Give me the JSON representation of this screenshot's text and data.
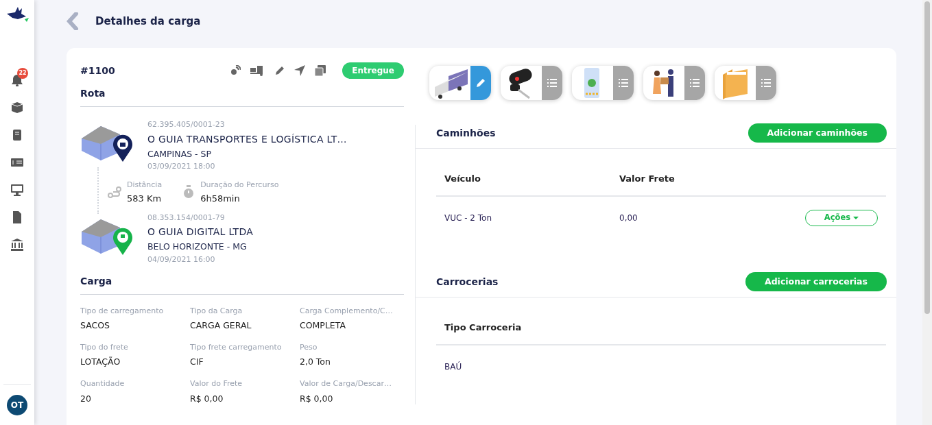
{
  "sidebar": {
    "notifications_badge": "22",
    "items": [
      {
        "kind": "bell"
      },
      {
        "kind": "box"
      },
      {
        "kind": "book"
      },
      {
        "kind": "money"
      },
      {
        "kind": "monitor"
      },
      {
        "kind": "file"
      },
      {
        "kind": "bank"
      }
    ],
    "avatar": "OT"
  },
  "page_title": "Detalhes da carga",
  "load": {
    "number": "#1100",
    "status": "Entregue",
    "route_title": "Rota",
    "origin": {
      "document": "62.395.405/0001-23",
      "name": "O GUIA TRANSPORTES E LOGÍSTICA LT…",
      "city": "CAMPINAS - SP",
      "datetime": "03/09/2021 18:00"
    },
    "distance": {
      "label": "Distância",
      "value": "583 Km"
    },
    "duration": {
      "label": "Duração do Percurso",
      "value": "6h58min"
    },
    "destination": {
      "document": "08.353.154/0001-79",
      "name": "O GUIA DIGITAL LTDA",
      "city": "BELO HORIZONTE - MG",
      "datetime": "04/09/2021 16:00"
    },
    "cargo_title": "Carga",
    "fields": [
      {
        "label": "Tipo de carregamento",
        "value": "SACOS"
      },
      {
        "label": "Tipo da Carga",
        "value": "CARGA GERAL"
      },
      {
        "label": "Carga Complemento/C…",
        "value": "COMPLETA"
      },
      {
        "label": "Tipo do frete",
        "value": "LOTAÇÃO"
      },
      {
        "label": "Tipo frete carregamento",
        "value": "CIF"
      },
      {
        "label": "Peso",
        "value": "2,0 Ton"
      },
      {
        "label": "Quantidade",
        "value": "20"
      },
      {
        "label": "Valor do Frete",
        "value": "R$ 0,00"
      },
      {
        "label": "Valor de Carga/Descar…",
        "value": "R$ 0,00"
      }
    ]
  },
  "tabs": [
    {
      "kind": "truck",
      "selected": true
    },
    {
      "kind": "keys",
      "selected": false
    },
    {
      "kind": "phone",
      "selected": false
    },
    {
      "kind": "delivery",
      "selected": false
    },
    {
      "kind": "folder",
      "selected": false
    }
  ],
  "trucks": {
    "title": "Caminhões",
    "add_button": "Adicionar caminhões",
    "columns": [
      "Veículo",
      "Valor Frete"
    ],
    "rows": [
      {
        "cells": [
          "VUC - 2 Ton",
          "0,00"
        ],
        "action": "Ações"
      }
    ]
  },
  "bodies": {
    "title": "Carrocerias",
    "add_button": "Adicionar carrocerias",
    "columns": [
      "Tipo Carroceria"
    ],
    "rows": [
      {
        "cells": [
          "BAÚ"
        ]
      }
    ]
  }
}
